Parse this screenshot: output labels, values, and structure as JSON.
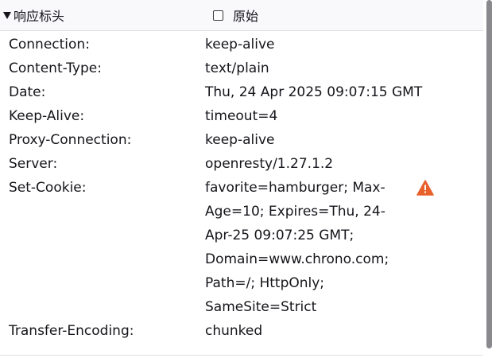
{
  "section": {
    "title": "响应标头",
    "raw_label": "原始",
    "raw_checked": false
  },
  "headers": [
    {
      "name": "Connection:",
      "value": "keep-alive"
    },
    {
      "name": "Content-Type:",
      "value": "text/plain"
    },
    {
      "name": "Date:",
      "value": "Thu, 24 Apr 2025 09:07:15 GMT"
    },
    {
      "name": "Keep-Alive:",
      "value": "timeout=4"
    },
    {
      "name": "Proxy-Connection:",
      "value": "keep-alive"
    },
    {
      "name": "Server:",
      "value": "openresty/1.27.1.2"
    },
    {
      "name": "Set-Cookie:",
      "value": "favorite=hamburger; Max-Age=10; Expires=Thu, 24-Apr-25 09:07:25 GMT; Domain=www.chrono.com; Path=/; HttpOnly; SameSite=Strict",
      "warning": true
    },
    {
      "name": "Transfer-Encoding:",
      "value": "chunked"
    }
  ],
  "icons": {
    "warning": "warning-icon",
    "expand": "disclosure-triangle-icon"
  },
  "colors": {
    "warning": "#e8602c",
    "header_bg": "#f9f9fb",
    "text": "#15141a"
  }
}
